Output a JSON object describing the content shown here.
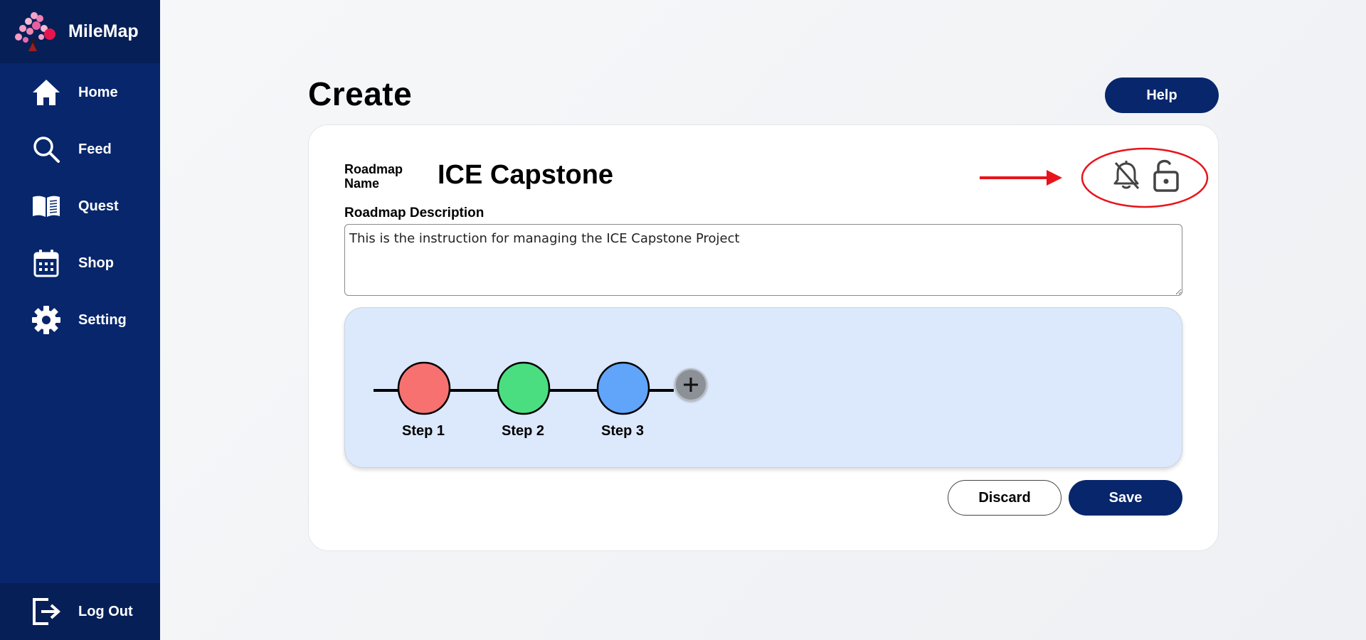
{
  "app": {
    "brand_name": "MileMap",
    "brand_icon": "blossom-tree-logo",
    "accent": "#07266c",
    "accent_dark": "#061f57"
  },
  "sidebar": {
    "items": [
      {
        "label": "Home",
        "icon": "home-icon"
      },
      {
        "label": "Feed",
        "icon": "search-icon"
      },
      {
        "label": "Quest",
        "icon": "book-icon"
      },
      {
        "label": "Shop",
        "icon": "calendar-icon"
      },
      {
        "label": "Setting",
        "icon": "gear-icon"
      }
    ],
    "logout": {
      "label": "Log Out",
      "icon": "logout-icon"
    }
  },
  "page": {
    "title": "Create",
    "help_label": "Help"
  },
  "roadmap": {
    "name_label": "Roadmap Name",
    "name_value": "ICE Capstone",
    "description_label": "Roadmap Description",
    "description_value": "This is the instruction for managing the ICE Capstone Project",
    "notification_icon": "bell-off-icon",
    "privacy_icon": "lock-open-icon",
    "annotation_color": "#e8141b",
    "steps": [
      {
        "label": "Step 1",
        "color": "#f87171"
      },
      {
        "label": "Step 2",
        "color": "#4ade80"
      },
      {
        "label": "Step 3",
        "color": "#60a5fa"
      }
    ],
    "add_step_icon": "plus-icon"
  },
  "actions": {
    "discard_label": "Discard",
    "save_label": "Save"
  }
}
